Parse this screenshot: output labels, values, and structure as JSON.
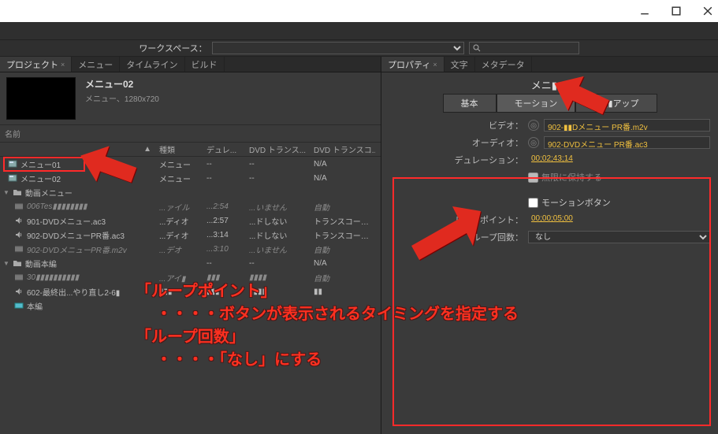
{
  "titlebar": {
    "min": "minimize",
    "max": "maximize",
    "close": "close"
  },
  "workspace": {
    "label": "ワークスペース："
  },
  "left": {
    "tabs": [
      "プロジェクト",
      "メニュー",
      "タイムライン",
      "ビルド"
    ],
    "selection": {
      "title": "メニュー02",
      "sub": "メニュー、1280x720"
    },
    "proj_header_label": "名前",
    "columns": {
      "type": "種類",
      "dur": "デュレ...",
      "dvd1": "DVD トランス...",
      "dvd2": "DVD トランスコ..."
    },
    "rows": [
      {
        "indent": 10,
        "icon": "menu",
        "name": "メニュー01",
        "type": "メニュー",
        "dur": "--",
        "dvd1": "--",
        "dvd2": "N/A"
      },
      {
        "indent": 10,
        "icon": "menu",
        "name": "メニュー02",
        "type": "メニュー",
        "dur": "--",
        "dvd1": "--",
        "dvd2": "N/A"
      },
      {
        "indent": 4,
        "icon": "folder",
        "name": "動画メニュー",
        "type": "",
        "dur": "",
        "dvd1": "",
        "dvd2": "",
        "arrow": "▼"
      },
      {
        "indent": 18,
        "icon": "video",
        "name": "006Tes▮▮▮▮▮▮▮▮",
        "type": "...ァイル",
        "dur": "...2:54",
        "dvd1": "...いません",
        "dvd2": "自動",
        "italic": true
      },
      {
        "indent": 18,
        "icon": "audio",
        "name": "901-DVDメニュー.ac3",
        "type": "...ディオ",
        "dur": "...2:57",
        "dvd1": "...ドしない",
        "dvd2": "トランスコード..."
      },
      {
        "indent": 18,
        "icon": "audio",
        "name": "902-DVDメニューPR番.ac3",
        "type": "...ディオ",
        "dur": "...3:14",
        "dvd1": "...ドしない",
        "dvd2": "トランスコード..."
      },
      {
        "indent": 18,
        "icon": "video",
        "name": "902-DVDメニューPR番.m2v",
        "type": "...デオ",
        "dur": "...3:10",
        "dvd1": "...いません",
        "dvd2": "自動",
        "italic": true
      },
      {
        "indent": 4,
        "icon": "folder",
        "name": "動画本編",
        "type": "",
        "dur": "--",
        "dvd1": "--",
        "dvd2": "N/A",
        "arrow": "▼"
      },
      {
        "indent": 18,
        "icon": "video",
        "name": "30▮▮▮▮▮▮▮▮▮▮",
        "type": "...アイ▮",
        "dur": "▮▮▮",
        "dvd1": "▮▮▮▮",
        "dvd2": "自動",
        "italic": true
      },
      {
        "indent": 18,
        "icon": "audio",
        "name": "602-最終出...やり直し2-6▮",
        "type": "▮▮▮",
        "dur": "▮▮▮",
        "dvd1": "▮▮▮▮",
        "dvd2": "▮▮"
      },
      {
        "indent": 18,
        "icon": "tl",
        "name": "本編",
        "type": "",
        "dur": "",
        "dvd1": "",
        "dvd2": ""
      }
    ]
  },
  "right": {
    "tabs": [
      "プロパティ",
      "文字",
      "メタデータ"
    ],
    "sel_title": "メニ▮▮▮",
    "subtabs": [
      "基本",
      "モーション",
      "▮▮▮▮アップ"
    ],
    "props": {
      "video_label": "ビデオ：",
      "video_val": "902-▮▮Dメニュー PR番.m2v",
      "audio_label": "オーディオ：",
      "audio_val": "902-DVDメニュー PR番.ac3",
      "duration_label": "デュレーション：",
      "duration_val": "00;02;43;14",
      "hold_label": "無限に保持する",
      "motion_btn_label": "モーションボタン",
      "loop_point_label": "ループポイント：",
      "loop_point_val": "00;00;05;00",
      "loop_count_label": "ループ回数：",
      "loop_count_val": "なし"
    }
  },
  "annotations": {
    "l1": "「ループポイント」",
    "l2": "・・・・ボタンが表示されるタイミングを指定する",
    "l3": "「ループ回数」",
    "l4": "・・・・「なし」にする"
  }
}
